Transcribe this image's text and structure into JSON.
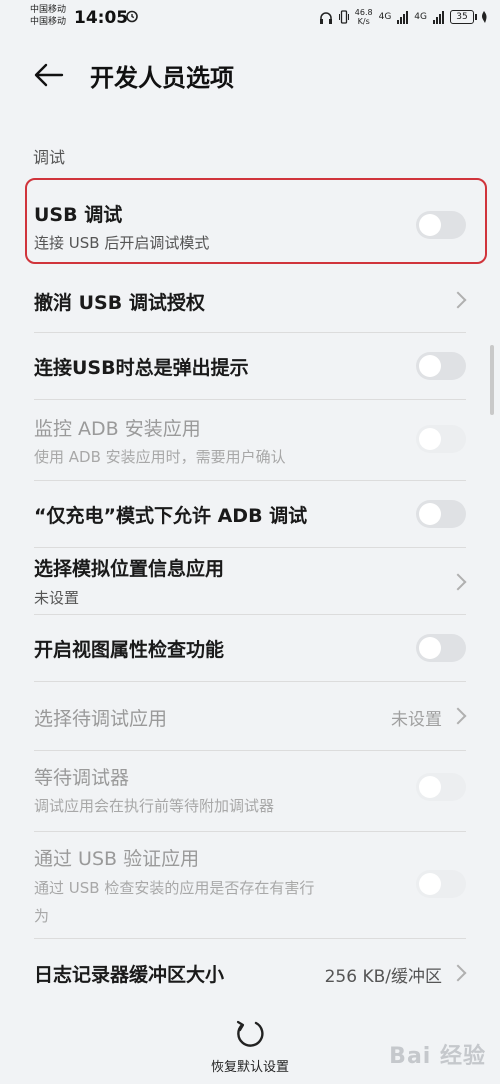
{
  "status_bar": {
    "carrier_1": "中国移动",
    "carrier_2": "中国移动",
    "time": "14:05",
    "net_speed_value": "46.8",
    "net_speed_unit": "K/s",
    "net_type_1": "4G",
    "net_type_2": "4G",
    "battery": "35"
  },
  "header": {
    "title": "开发人员选项"
  },
  "section": {
    "label": "调试"
  },
  "items": [
    {
      "title": "USB 调试",
      "subtitle": "连接 USB 后开启调试模式",
      "control": "toggle",
      "enabled": true,
      "on": false
    },
    {
      "title": "撤消 USB 调试授权",
      "control": "chevron",
      "enabled": true
    },
    {
      "title": "连接USB时总是弹出提示",
      "control": "toggle",
      "enabled": true,
      "on": false
    },
    {
      "title": "监控 ADB 安装应用",
      "subtitle": "使用 ADB 安装应用时，需要用户确认",
      "control": "toggle",
      "enabled": false,
      "on": false
    },
    {
      "title": "“仅充电”模式下允许 ADB 调试",
      "control": "toggle",
      "enabled": true,
      "on": false
    },
    {
      "title": "选择模拟位置信息应用",
      "subtitle": "未设置",
      "control": "chevron",
      "enabled": true
    },
    {
      "title": "开启视图属性检查功能",
      "control": "toggle",
      "enabled": true,
      "on": false
    },
    {
      "title": "选择待调试应用",
      "value": "未设置",
      "control": "chevron",
      "enabled": false
    },
    {
      "title": "等待调试器",
      "subtitle": "调试应用会在执行前等待附加调试器",
      "control": "toggle",
      "enabled": false,
      "on": false
    },
    {
      "title": "通过 USB 验证应用",
      "subtitle": "通过 USB 检查安装的应用是否存在有害行",
      "subtitle_2": "为",
      "control": "toggle",
      "enabled": false,
      "on": false
    },
    {
      "title": "日志记录器缓冲区大小",
      "value": "256 KB/缓冲区",
      "control": "chevron",
      "enabled": true
    }
  ],
  "bottom": {
    "reset_label": "恢复默认设置",
    "watermark": "Bai 经验"
  },
  "colors": {
    "background": "#f1f3f5",
    "highlight_border": "#d0343b",
    "toggle_off": "#dfe1e4"
  }
}
